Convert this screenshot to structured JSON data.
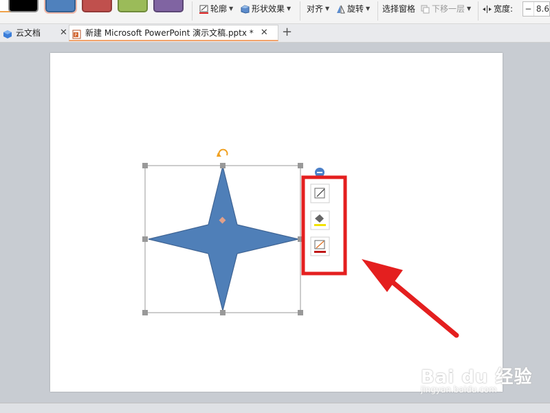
{
  "ribbon": {
    "outline_label": "轮廓",
    "shape_effect_label": "形状效果",
    "align_label": "对齐",
    "rotate_label": "旋转",
    "select_pane_label": "选择窗格",
    "send_backward_label": "下移一层",
    "width_label": "宽度:",
    "width_value": "8.6"
  },
  "shape_styles": [
    {
      "name": "black",
      "color": "#000000"
    },
    {
      "name": "blue",
      "color": "#4f81bd"
    },
    {
      "name": "red",
      "color": "#c0504d"
    },
    {
      "name": "green",
      "color": "#9bbb59"
    },
    {
      "name": "purple",
      "color": "#8064a2"
    }
  ],
  "tabs": [
    {
      "label": "云文档"
    },
    {
      "label": "新建 Microsoft PowerPoint 演示文稿.pptx *"
    }
  ],
  "shape": {
    "fill": "#4f7fb8",
    "stroke": "#3f6494"
  },
  "annotation": {
    "color": "#e41f1f"
  },
  "watermark": {
    "brand": "Bai du 经验",
    "url": "jingyan.baidu.com"
  }
}
